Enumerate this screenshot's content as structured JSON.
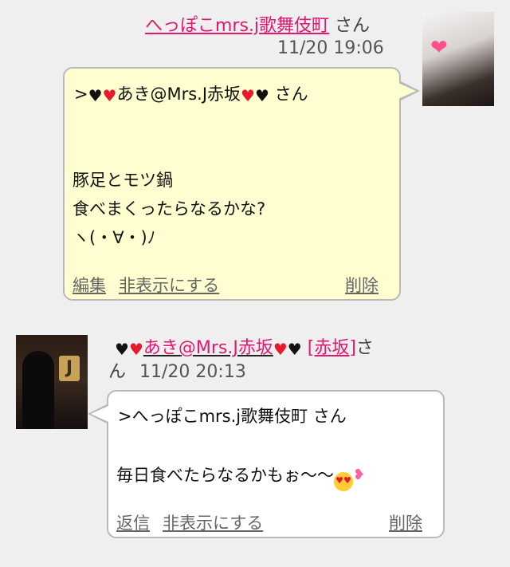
{
  "msg1": {
    "author": "へっぽこmrs.j歌舞伎町",
    "honorific": "さん",
    "time": "11/20 19:06",
    "reply_prefix": ">",
    "reply_hearts_left": [
      "🖤",
      "❤️"
    ],
    "reply_name": "あき@Mrs.J赤坂",
    "reply_hearts_right": [
      "❤️",
      "🖤"
    ],
    "reply_suffix": "さん",
    "body_lines": [
      "豚足とモツ鍋",
      "食べまくったらなるかな?",
      "ヽ(・∀・)ﾉ"
    ],
    "actions": {
      "edit": "編集",
      "hide": "非表示にする",
      "delete": "削除"
    }
  },
  "msg2": {
    "author_hearts_left": [
      "🖤",
      "❤️"
    ],
    "author": "あき@Mrs.J赤坂",
    "author_hearts_right": [
      "❤️",
      "🖤"
    ],
    "tag": "[赤坂]",
    "honorific_a": "さ",
    "honorific_b": "ん",
    "time": "11/20 20:13",
    "reply_line": ">へっぽこmrs.j歌舞伎町 さん",
    "body": "毎日食べたらなるかもぉ〜〜",
    "body_emojis": [
      "😍",
      "💕"
    ],
    "actions": {
      "reply": "返信",
      "hide": "非表示にする",
      "delete": "削除"
    }
  },
  "colors": {
    "accent": "#e0186f",
    "bubble1": "#fefed0",
    "bubble2": "#ffffff",
    "border": "#b9b9b9",
    "bg": "#efefef"
  }
}
